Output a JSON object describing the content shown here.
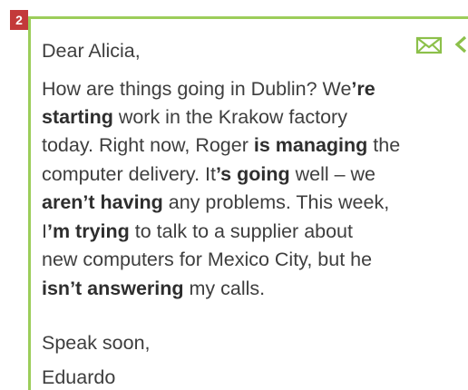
{
  "exercise": {
    "number": "2"
  },
  "icons": {
    "mail": "envelope-icon",
    "back": "chevron-left-icon",
    "accent_color": "#9ccd5a",
    "badge_color": "#c33a3a"
  },
  "letter": {
    "greeting": "Dear Alicia,",
    "body_lines": [
      [
        {
          "t": "How are things going in Dublin? We",
          "b": false
        },
        {
          "t": "’re",
          "b": true
        }
      ],
      [
        {
          "t": "starting",
          "b": true
        },
        {
          "t": " work in the Krakow factory",
          "b": false
        }
      ],
      [
        {
          "t": "today. Right now, Roger ",
          "b": false
        },
        {
          "t": "is managing",
          "b": true
        },
        {
          "t": " the",
          "b": false
        }
      ],
      [
        {
          "t": "computer delivery. It",
          "b": false
        },
        {
          "t": "’s going",
          "b": true
        },
        {
          "t": " well – we",
          "b": false
        }
      ],
      [
        {
          "t": "aren’t having",
          "b": true
        },
        {
          "t": " any problems. This week,",
          "b": false
        }
      ],
      [
        {
          "t": "I",
          "b": false
        },
        {
          "t": "’m trying",
          "b": true
        },
        {
          "t": " to talk to a supplier about",
          "b": false
        }
      ],
      [
        {
          "t": "new computers for Mexico City, but he",
          "b": false
        }
      ],
      [
        {
          "t": "isn’t answering",
          "b": true
        },
        {
          "t": " my calls.",
          "b": false
        }
      ]
    ],
    "closing": "Speak soon,",
    "signature": "Eduardo"
  }
}
